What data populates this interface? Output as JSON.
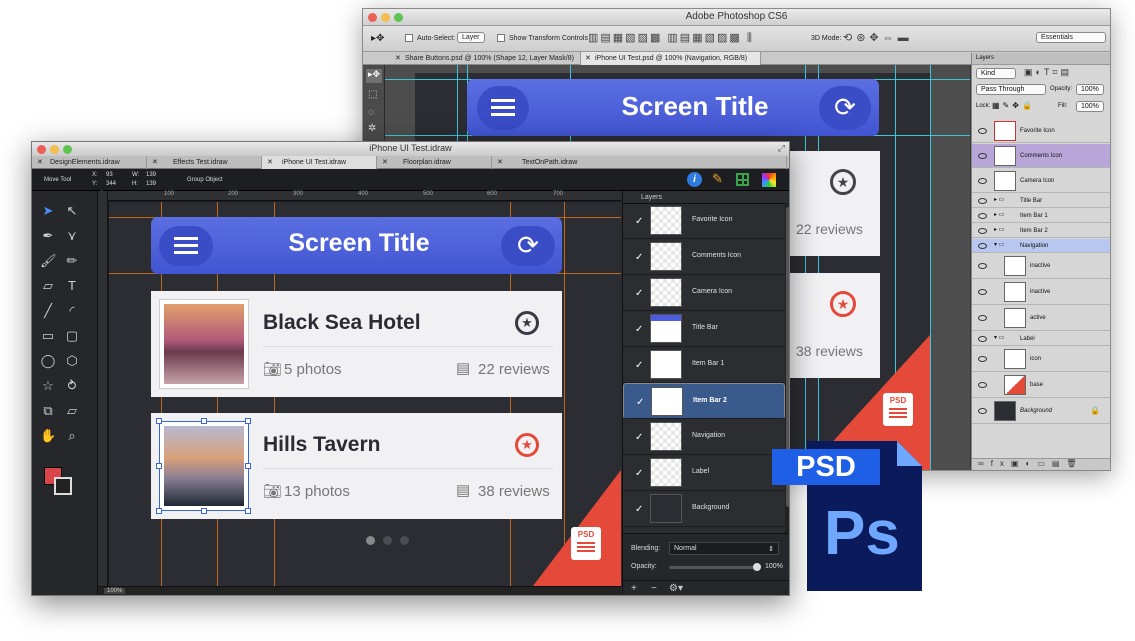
{
  "photoshop": {
    "title": "Adobe Photoshop CS6",
    "options": {
      "auto_select_label": "Auto-Select:",
      "auto_select_value": "Layer",
      "show_transform_label": "Show Transform Controls",
      "mode_3d_label": "3D Mode:",
      "workspace": "Essentials"
    },
    "tabs": [
      {
        "label": "Share Buttons.psd @ 100% (Shape 12, Layer Mask/8)"
      },
      {
        "label": "iPhone UI Test.psd @ 100% (Navigation, RGB/8)"
      }
    ],
    "canvas": {
      "screen_title": "Screen Title",
      "reviews_1": "22 reviews",
      "reviews_2": "38 reviews",
      "badge": "PSD"
    },
    "layers_panel": {
      "title": "Layers",
      "filter": "Kind",
      "blend": "Pass Through",
      "opacity_label": "Opacity:",
      "opacity": "100%",
      "lock_label": "Lock:",
      "fill_label": "Fill:",
      "fill": "100%",
      "layers": [
        "Favorite Icon",
        "Comments Icon",
        "Camera Icon",
        "Title Bar",
        "Item Bar 1",
        "Item Bar 2",
        "Navigation",
        "inactive",
        "inactive",
        "active",
        "Label",
        "icon",
        "base",
        "Background"
      ]
    }
  },
  "idraw": {
    "title": "iPhone UI Test.idraw",
    "tabs": [
      {
        "label": "DesignElements.idraw"
      },
      {
        "label": "Effects Test.idraw"
      },
      {
        "label": "iPhone UI Test.idraw"
      },
      {
        "label": "Floorplan.idraw"
      },
      {
        "label": "TextOnPath.idraw"
      }
    ],
    "toolbar": {
      "tool_name": "Move Tool",
      "x_label": "X:",
      "x_val": "93",
      "y_label": "Y:",
      "y_val": "344",
      "w_label": "W:",
      "w_val": "139",
      "h_label": "H:",
      "h_val": "139",
      "group": "Group Object"
    },
    "ruler": [
      "0",
      "100",
      "200",
      "300",
      "400",
      "500",
      "600",
      "700"
    ],
    "zoom": "100%",
    "mockup": {
      "screen_title": "Screen Title",
      "items": [
        {
          "title": "Black Sea Hotel",
          "photos": "5 photos",
          "reviews": "22 reviews"
        },
        {
          "title": "Hills Tavern",
          "photos": "13 photos",
          "reviews": "38 reviews"
        }
      ],
      "badge": "PSD"
    },
    "layers": {
      "title": "Layers",
      "rows": [
        "Favorite Icon",
        "Comments Icon",
        "Camera Icon",
        "Title Bar",
        "Item Bar 1",
        "Item Bar 2",
        "Navigation",
        "Label",
        "Background"
      ],
      "blending_label": "Blending:",
      "blending_value": "Normal",
      "opacity_label": "Opacity:",
      "opacity_value": "100%"
    }
  },
  "psd_icon": {
    "top": "PSD",
    "bottom": "Ps"
  },
  "colors": {
    "accent_blue": "#4a5de0",
    "accent_red": "#e5493a",
    "guide_orange": "#e0781e",
    "guide_cyan": "#3ec6d8"
  }
}
